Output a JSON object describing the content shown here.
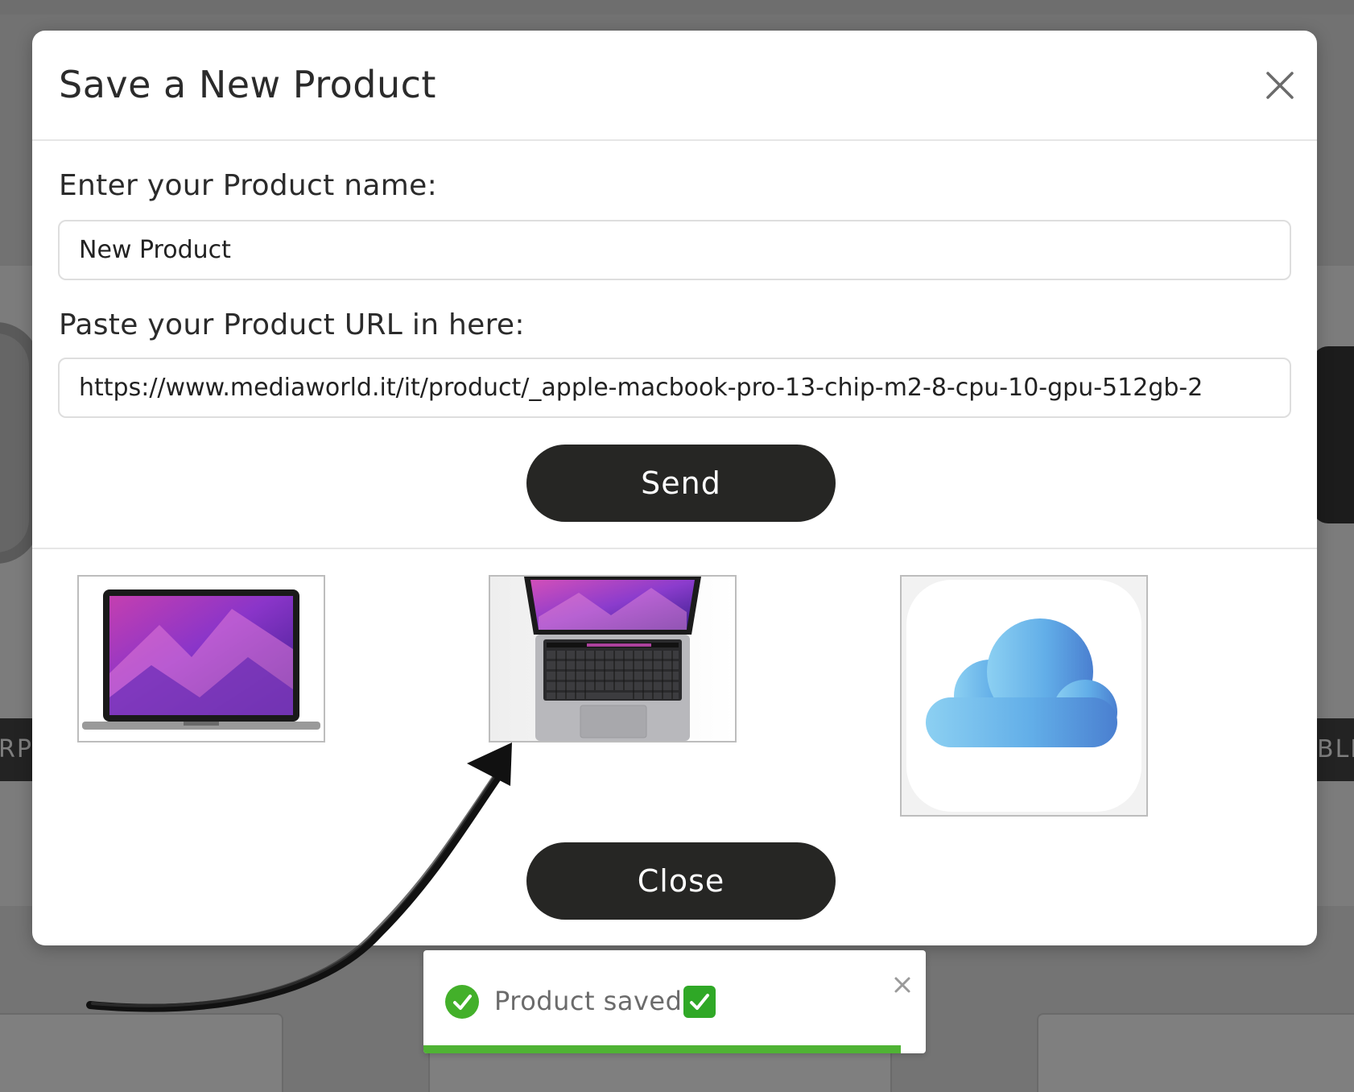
{
  "background": {
    "left_label": "RPC",
    "right_label": "BLK"
  },
  "modal": {
    "title": "Save a New Product",
    "close_icon": "close-icon",
    "name_label": "Enter your Product name:",
    "name_value": "New Product",
    "url_label": "Paste your Product URL in here:",
    "url_value": "https://www.mediaworld.it/it/product/_apple-macbook-pro-13-chip-m2-8-cpu-10-gpu-512gb-2",
    "send_label": "Send",
    "close_label": "Close",
    "images": [
      {
        "name": "macbook-front-image"
      },
      {
        "name": "macbook-open-keyboard-image"
      },
      {
        "name": "icloud-icon-image"
      }
    ]
  },
  "toast": {
    "message": "Product saved",
    "status_icon": "check-circle-icon",
    "emoji_icon": "check-mark-button-emoji",
    "close_icon": "close-icon",
    "progress": 0.95,
    "accent_color": "#4fb334"
  },
  "annotation": {
    "arrow": "hand-drawn-arrow"
  }
}
